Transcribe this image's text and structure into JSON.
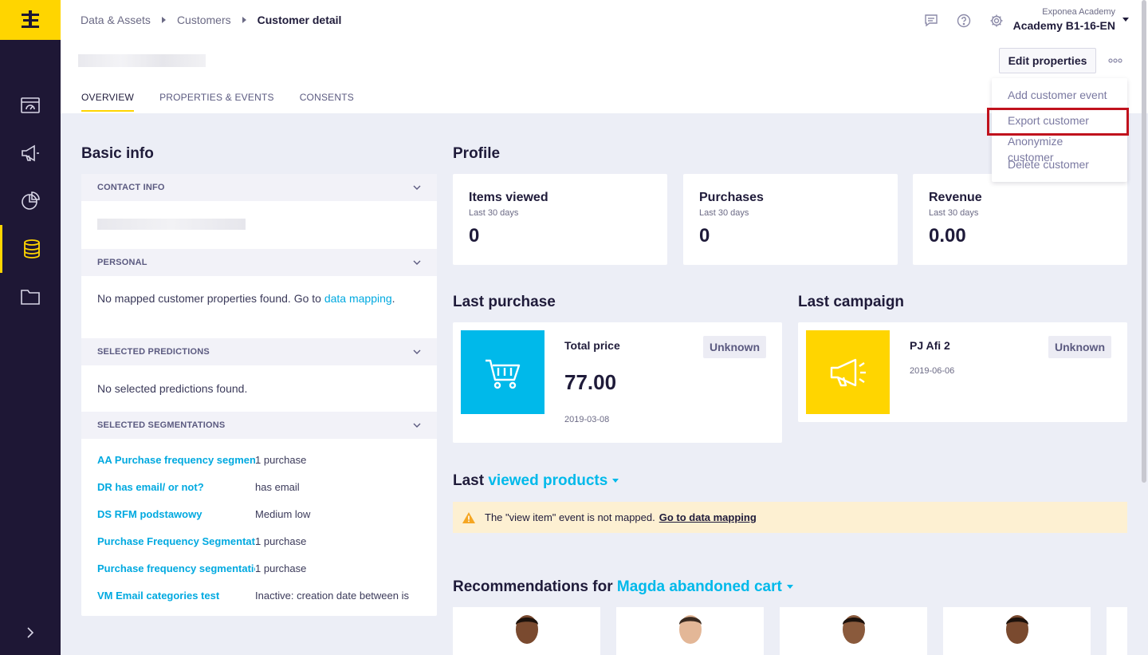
{
  "breadcrumb": [
    "Data & Assets",
    "Customers",
    "Customer detail"
  ],
  "account": {
    "org": "Exponea Academy",
    "project": "Academy B1-16-EN"
  },
  "tabs": [
    "OVERVIEW",
    "PROPERTIES & EVENTS",
    "CONSENTS"
  ],
  "actions": {
    "edit_properties": "Edit properties",
    "menu": [
      "Add customer event",
      "Export customer",
      "Anonymize customer",
      "Delete customer"
    ]
  },
  "basic_info": {
    "title": "Basic info",
    "contact_header": "CONTACT INFO",
    "personal_header": "PERSONAL",
    "personal_text": "No mapped customer properties found. Go to",
    "personal_link": "data mapping",
    "predictions_header": "SELECTED PREDICTIONS",
    "predictions_text": "No selected predictions found.",
    "segmentations_header": "SELECTED SEGMENTATIONS",
    "segmentations": [
      {
        "name": "AA Purchase frequency segment",
        "value": "1 purchase"
      },
      {
        "name": "DR has email/ or not?",
        "value": "has email"
      },
      {
        "name": "DS RFM podstawowy",
        "value": "Medium low"
      },
      {
        "name": "Purchase Frequency Segmentation",
        "value": "1 purchase"
      },
      {
        "name": "Purchase frequency segmentation",
        "value": "1 purchase"
      },
      {
        "name": "VM Email categories test",
        "value": "Inactive: creation date between is"
      }
    ]
  },
  "profile": {
    "title": "Profile",
    "stats": [
      {
        "title": "Items viewed",
        "period": "Last 30 days",
        "value": "0"
      },
      {
        "title": "Purchases",
        "period": "Last 30 days",
        "value": "0"
      },
      {
        "title": "Revenue",
        "period": "Last 30 days",
        "value": "0.00"
      }
    ]
  },
  "last_purchase": {
    "title": "Last purchase",
    "label": "Total price",
    "value": "77.00",
    "date": "2019-03-08",
    "badge": "Unknown"
  },
  "last_campaign": {
    "title": "Last campaign",
    "name": "PJ Afi 2",
    "date": "2019-06-06",
    "badge": "Unknown"
  },
  "viewed": {
    "prefix": "Last",
    "link": "viewed products",
    "warning": "The \"view item\" event is not mapped.",
    "warning_link": "Go to data mapping"
  },
  "recommendations": {
    "prefix": "Recommendations for",
    "link": "Magda abandoned cart"
  },
  "colors": {
    "brand": "#ffd500",
    "sidebar": "#1e1735",
    "accent": "#00b9ea",
    "highlight": "#c0121d"
  }
}
